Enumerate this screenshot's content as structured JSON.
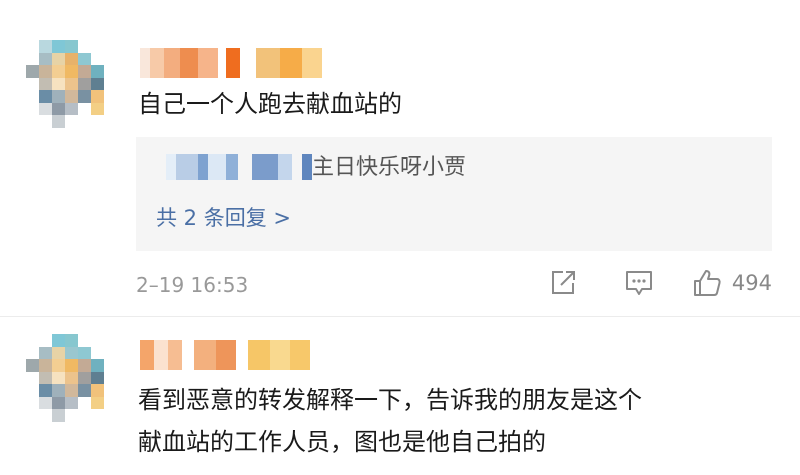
{
  "comments": [
    {
      "text": "自己一个人跑去献血站的",
      "reply": {
        "text": "主日快乐呀小贾",
        "more_label": "共 2 条回复 >"
      },
      "timestamp": "2–19 16:53",
      "like_count": "494",
      "icons": [
        "share-icon",
        "comment-icon",
        "like-icon"
      ]
    },
    {
      "text_lines": [
        "看到恶意的转发解释一下，告诉我的朋友是这个",
        "献血站的工作人员，图也是他自己拍的"
      ]
    }
  ],
  "colors": {
    "body_text": "#1a1a1a",
    "reply_bg": "#f5f5f5",
    "link": "#4a6fa5",
    "meta": "#999999"
  }
}
